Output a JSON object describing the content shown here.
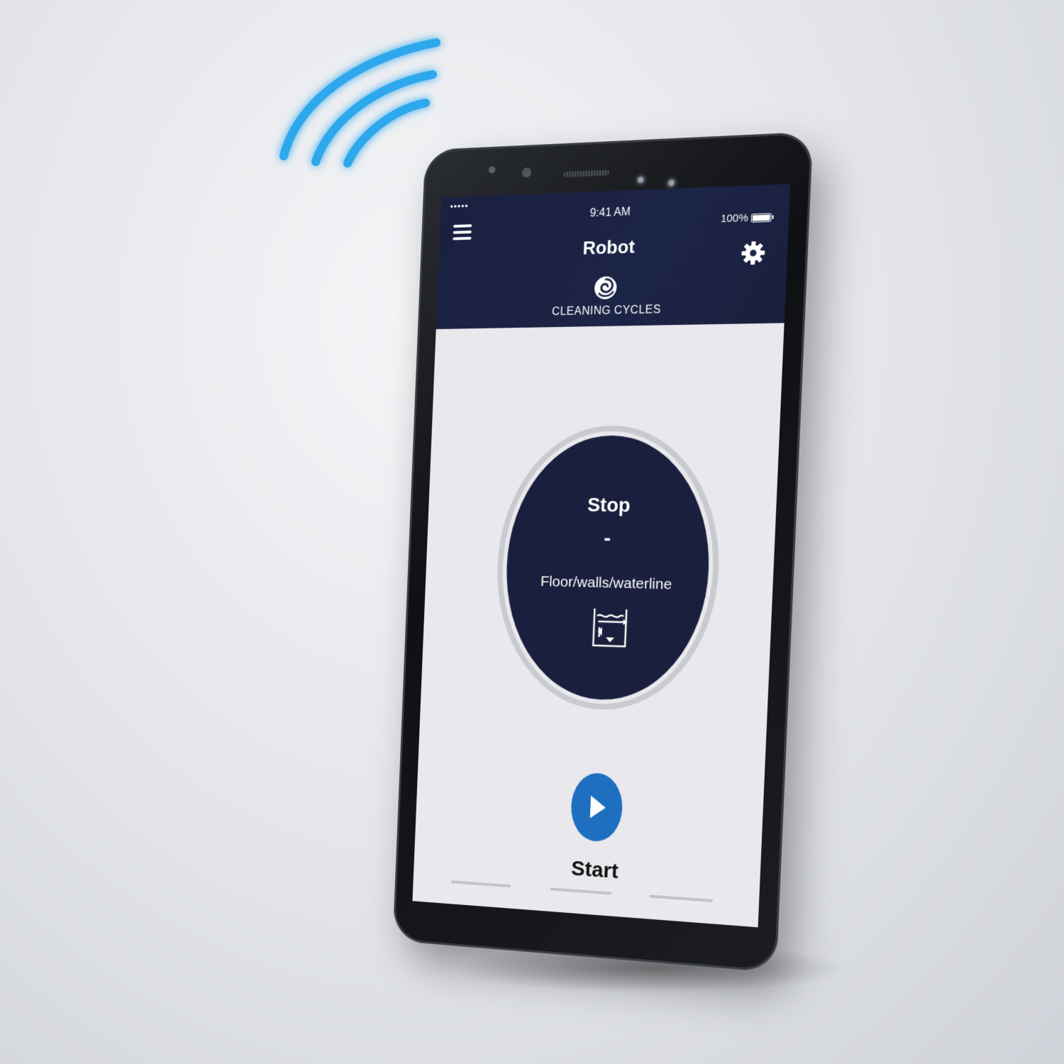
{
  "status_bar": {
    "signal": "•••••",
    "time": "9:41 AM",
    "battery": "100%"
  },
  "header": {
    "title": "Robot",
    "section_label": "CLEANING CYCLES"
  },
  "cycle": {
    "state": "Stop",
    "separator": "-",
    "mode": "Floor/walls/waterline"
  },
  "actions": {
    "start_label": "Start"
  },
  "colors": {
    "header_bg": "#1a2040",
    "disc": "#1a1f3d",
    "start_button": "#1f6fc0",
    "wifi_glow": "#2fb4f0"
  },
  "icons": {
    "menu": "hamburger-icon",
    "settings": "gear-icon",
    "cleaning_cycles": "swirl-icon",
    "mode": "pool-cleaning-icon",
    "start": "play-icon",
    "connectivity": "wifi-signal-icon"
  }
}
